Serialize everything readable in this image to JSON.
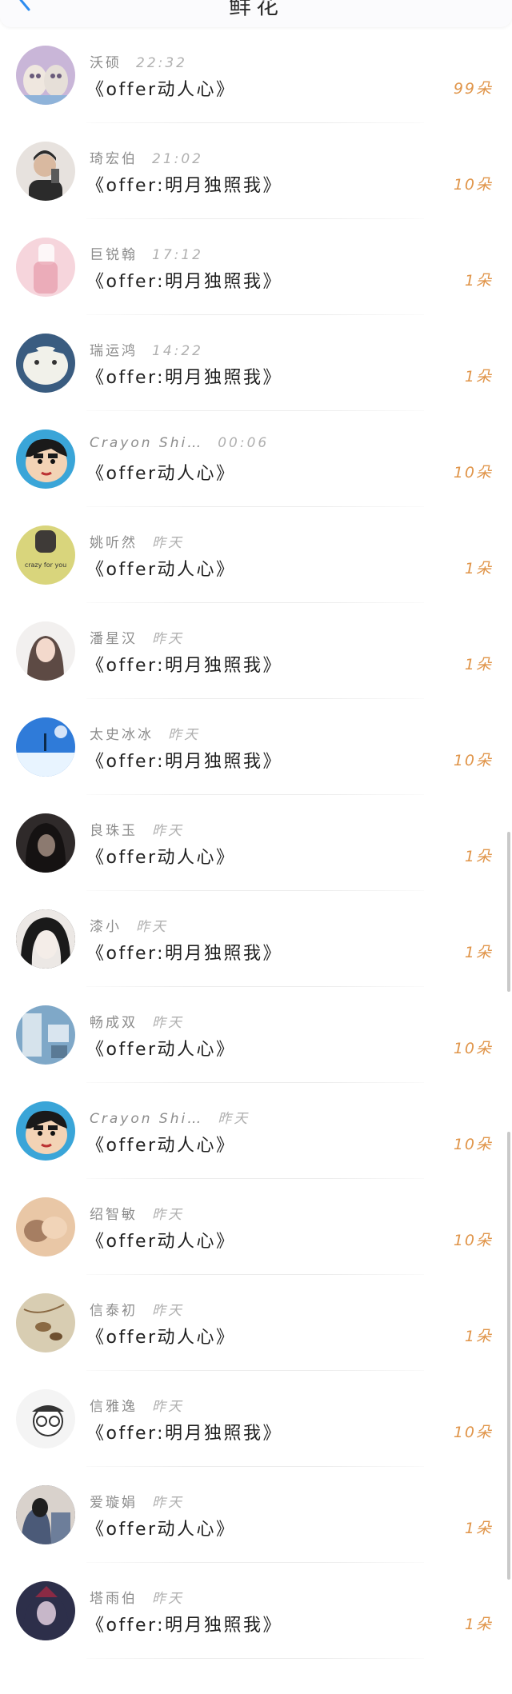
{
  "header": {
    "title": "鲜花",
    "back_icon": "chevron-left-icon",
    "accent": "#2d8cf0"
  },
  "colors": {
    "count": "#e0954a",
    "name": "#8c8c8c",
    "gift_text": "#1f1f1f"
  },
  "items": [
    {
      "name": "沃硕",
      "time": "22:32",
      "gift": "《offer动人心》",
      "count": "99朵",
      "avatar": "cats-icon",
      "c1": "#c9b6d8",
      "c2": "#6a5b7b"
    },
    {
      "name": "琦宏伯",
      "time": "21:02",
      "gift": "《offer:明月独照我》",
      "count": "10朵",
      "avatar": "person-icon",
      "c1": "#e7e2de",
      "c2": "#2b2b2b"
    },
    {
      "name": "巨锐翰",
      "time": "17:12",
      "gift": "《offer:明月独照我》",
      "count": "1朵",
      "avatar": "pink-figure-icon",
      "c1": "#f6d5dc",
      "c2": "#e79aa9"
    },
    {
      "name": "瑞运鸿",
      "time": "14:22",
      "gift": "《offer:明月独照我》",
      "count": "1朵",
      "avatar": "cat-mask-icon",
      "c1": "#3a5c80",
      "c2": "#f1f1ea"
    },
    {
      "name": "Crayon Shi…",
      "time": "00:06",
      "gift": "《offer动人心》",
      "count": "10朵",
      "avatar": "crayon-shin-icon",
      "c1": "#3aa5d8",
      "c2": "#f3d3b5"
    },
    {
      "name": "姚听然",
      "time": "昨天",
      "gift": "《offer动人心》",
      "count": "1朵",
      "avatar": "crazy-for-you-icon",
      "c1": "#d9d57c",
      "c2": "#3e3a37"
    },
    {
      "name": "潘星汉",
      "time": "昨天",
      "gift": "《offer:明月独照我》",
      "count": "1朵",
      "avatar": "girl-portrait-icon",
      "c1": "#f2f0ef",
      "c2": "#5d4a44"
    },
    {
      "name": "太史冰冰",
      "time": "昨天",
      "gift": "《offer:明月独照我》",
      "count": "10朵",
      "avatar": "sky-icon",
      "c1": "#2f7bd9",
      "c2": "#e8f4ff"
    },
    {
      "name": "良珠玉",
      "time": "昨天",
      "gift": "《offer动人心》",
      "count": "1朵",
      "avatar": "dark-hair-icon",
      "c1": "#2f2a2a",
      "c2": "#8c7a70"
    },
    {
      "name": "漆小",
      "time": "昨天",
      "gift": "《offer:明月独照我》",
      "count": "1朵",
      "avatar": "anime-girl-icon",
      "c1": "#1a1a1a",
      "c2": "#ece8e5"
    },
    {
      "name": "畅成双",
      "time": "昨天",
      "gift": "《offer动人心》",
      "count": "10朵",
      "avatar": "room-icon",
      "c1": "#7fa8c8",
      "c2": "#d6e3ec"
    },
    {
      "name": "Crayon Shi…",
      "time": "昨天",
      "gift": "《offer动人心》",
      "count": "10朵",
      "avatar": "crayon-shin-icon",
      "c1": "#3aa5d8",
      "c2": "#f3d3b5"
    },
    {
      "name": "绍智敏",
      "time": "昨天",
      "gift": "《offer动人心》",
      "count": "10朵",
      "avatar": "hands-icon",
      "c1": "#e9c7a6",
      "c2": "#7a4d36"
    },
    {
      "name": "信泰初",
      "time": "昨天",
      "gift": "《offer动人心》",
      "count": "1朵",
      "avatar": "birds-painting-icon",
      "c1": "#d8cdb2",
      "c2": "#8a6a44"
    },
    {
      "name": "信雅逸",
      "time": "昨天",
      "gift": "《offer:明月独照我》",
      "count": "10朵",
      "avatar": "glasses-cartoon-icon",
      "c1": "#f4f4f4",
      "c2": "#333333"
    },
    {
      "name": "爱璇娟",
      "time": "昨天",
      "gift": "《offer动人心》",
      "count": "1朵",
      "avatar": "couple-icon",
      "c1": "#4b5a78",
      "c2": "#d9d2cc"
    },
    {
      "name": "塔雨伯",
      "time": "昨天",
      "gift": "《offer:明月独照我》",
      "count": "1朵",
      "avatar": "warrior-icon",
      "c1": "#2d2f4a",
      "c2": "#c7b7c9"
    }
  ]
}
